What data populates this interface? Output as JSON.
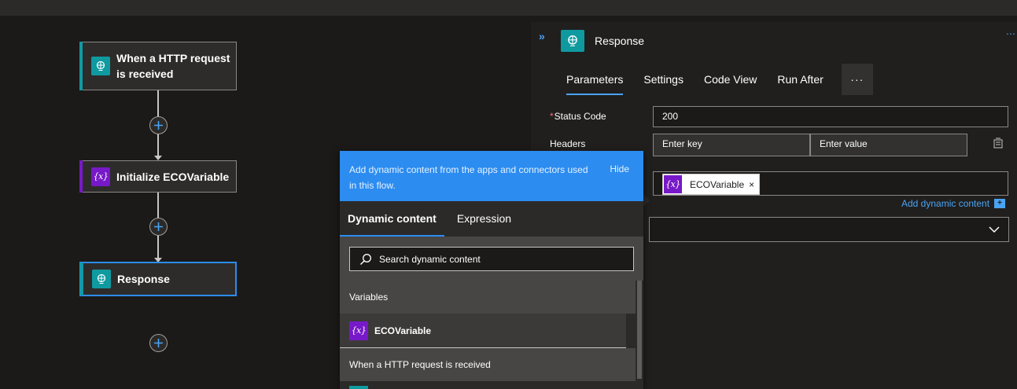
{
  "canvas": {
    "cards": [
      {
        "title_line1": "When a HTTP request",
        "title_line2": "is received",
        "icon": "http-request-icon",
        "accent": "#0f9aa0"
      },
      {
        "title": "Initialize ECOVariable",
        "icon": "variable-icon",
        "accent": "#7719c8"
      },
      {
        "title": "Response",
        "icon": "response-icon",
        "accent": "#0f9aa0"
      }
    ],
    "add_step_icon": "plus-icon"
  },
  "panel": {
    "title": "Response",
    "collapse_label": "»",
    "more_label": "⋯",
    "tabs": [
      "Parameters",
      "Settings",
      "Code View",
      "Run After"
    ],
    "tabs_more": "···",
    "status_code": {
      "label": "Status Code",
      "required_mark": "*",
      "value": "200"
    },
    "headers": {
      "label": "Headers",
      "key_placeholder": "Enter key",
      "value_placeholder": "Enter value"
    },
    "body_token": {
      "label": "ECOVariable",
      "remove": "×",
      "icon_text": "{x}"
    },
    "add_dynamic_content": "Add dynamic content",
    "add_box": "+",
    "select_chevron": "⌄"
  },
  "popup": {
    "message": "Add dynamic content from the apps and connectors used in this flow.",
    "hide_label": "Hide",
    "tabs": [
      "Dynamic content",
      "Expression"
    ],
    "search_placeholder": "Search dynamic content",
    "sections": [
      {
        "title": "Variables",
        "items": [
          {
            "label": "ECOVariable",
            "icon_text": "{x}"
          }
        ]
      },
      {
        "title": "When a HTTP request is received"
      }
    ]
  },
  "colors": {
    "accent_blue": "#2c8cf0",
    "teal": "#0f9aa0",
    "purple": "#7719c8"
  }
}
